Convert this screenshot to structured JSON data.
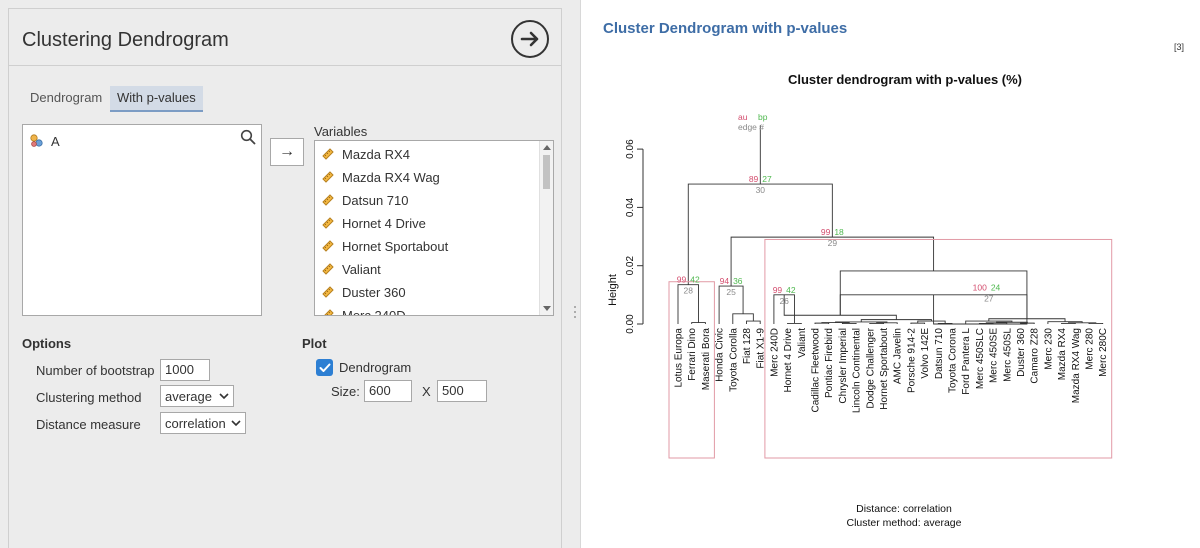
{
  "header": {
    "title": "Clustering Dendrogram"
  },
  "tabs": [
    {
      "label": "Dendrogram",
      "active": false
    },
    {
      "label": "With p-values",
      "active": true
    }
  ],
  "source": {
    "item": "A"
  },
  "variables": {
    "label": "Variables",
    "items": [
      "Mazda RX4",
      "Mazda RX4 Wag",
      "Datsun 710",
      "Hornet 4 Drive",
      "Hornet Sportabout",
      "Valiant",
      "Duster 360",
      "Merc 240D"
    ]
  },
  "move_button": "→",
  "options": {
    "title": "Options",
    "bootstrap_label": "Number of bootstrap",
    "bootstrap_value": "1000",
    "method_label": "Clustering method",
    "method_value": "average",
    "distance_label": "Distance measure",
    "distance_value": "correlation"
  },
  "plot": {
    "title": "Plot",
    "dendrogram_label": "Dendrogram",
    "dendrogram_checked": true,
    "size_label": "Size:",
    "width_value": "600",
    "x_label": "X",
    "height_value": "500"
  },
  "results": {
    "title": "Cluster Dendrogram with p-values",
    "ref": "[3]",
    "chart_title": "Cluster dendrogram with p-values (%)",
    "ylabel": "Height",
    "y_ticks": [
      "0.00",
      "0.02",
      "0.04",
      "0.06"
    ],
    "legend_au": "au",
    "legend_bp": "bp",
    "legend_edge": "edge #",
    "footer_distance": "Distance:  correlation",
    "footer_method": "Cluster method: average",
    "leaves": [
      "Lotus Europa",
      "Ferrari Dino",
      "Maserati Bora",
      "Honda Civic",
      "Toyota Corolla",
      "Fiat 128",
      "Fiat X1-9",
      "Merc 240D",
      "Hornet 4 Drive",
      "Valiant",
      "Cadillac Fleetwood",
      "Pontiac Firebird",
      "Chrysler Imperial",
      "Lincoln Continental",
      "Dodge Challenger",
      "Hornet Sportabout",
      "AMC Javelin",
      "Porsche 914-2",
      "Volvo 142E",
      "Datsun 710",
      "Toyota Corona",
      "Ford Pantera L",
      "Merc 450SLC",
      "Merc 450SE",
      "Merc 450SL",
      "Duster 360",
      "Camaro Z28",
      "Merc 230",
      "Mazda RX4",
      "Mazda RX4 Wag",
      "Merc 280",
      "Merc 280C"
    ],
    "node_labels": [
      {
        "au": "89",
        "bp": "27",
        "edge": "30"
      },
      {
        "au": "99",
        "bp": "18",
        "edge": "29"
      },
      {
        "au": "99",
        "bp": "42",
        "edge": "28"
      },
      {
        "au": "100",
        "bp": "24",
        "edge": "27"
      },
      {
        "au": "99",
        "bp": "42",
        "edge": "26"
      },
      {
        "au": "94",
        "bp": "36",
        "edge": "25"
      }
    ]
  },
  "colors": {
    "accent": "#3e6da6",
    "au": "#d34d6e",
    "bp": "#4fb84f",
    "edge": "#8a8a8a",
    "rect": "#e29aa6"
  }
}
